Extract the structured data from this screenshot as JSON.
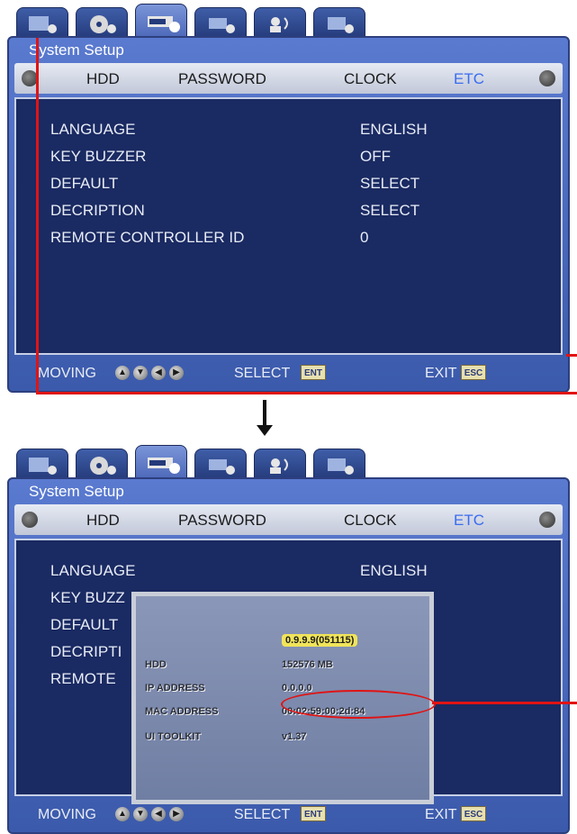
{
  "window_title": "System Setup",
  "menu": [
    "HDD",
    "PASSWORD",
    "CLOCK",
    "ETC"
  ],
  "settings": [
    {
      "label": "LANGUAGE",
      "value": "ENGLISH"
    },
    {
      "label": "KEY BUZZER",
      "value": "OFF"
    },
    {
      "label": "DEFAULT",
      "value": "SELECT"
    },
    {
      "label": "DECRIPTION",
      "value": "SELECT"
    },
    {
      "label": "REMOTE CONTROLLER ID",
      "value": "0"
    }
  ],
  "footer": {
    "moving": "MOVING",
    "select": "SELECT",
    "exit": "EXIT",
    "enter_key": "ENT",
    "esc_key": "ESC"
  },
  "screen2_partial": {
    "key_buzzer": "KEY BUZZ",
    "default": "DEFAULT",
    "decription": "DECRIPTI",
    "remote": "REMOTE"
  },
  "system_info": {
    "version": "0.9.9.9(051115)",
    "hdd_label": "HDD",
    "hdd_value": "152576 MB",
    "ip_label": "IP ADDRESS",
    "ip_value": "0.0.0.0",
    "mac_label": "MAC ADDRESS",
    "mac_value": "00:02:59:00:2d:84",
    "ui_label": "UI TOOLKIT",
    "ui_value": "v1.37"
  },
  "icons": [
    "monitor-gear-icon",
    "disc-gear-icon",
    "hdd-gear-icon",
    "camera-gear-icon",
    "user-network-icon",
    "case-gear-icon",
    "left-arrow-icon",
    "right-arrow-icon",
    "up-arrow-icon",
    "down-arrow-icon"
  ],
  "colors": {
    "highlight": "#3b6cf0",
    "annotation": "#e01414"
  }
}
